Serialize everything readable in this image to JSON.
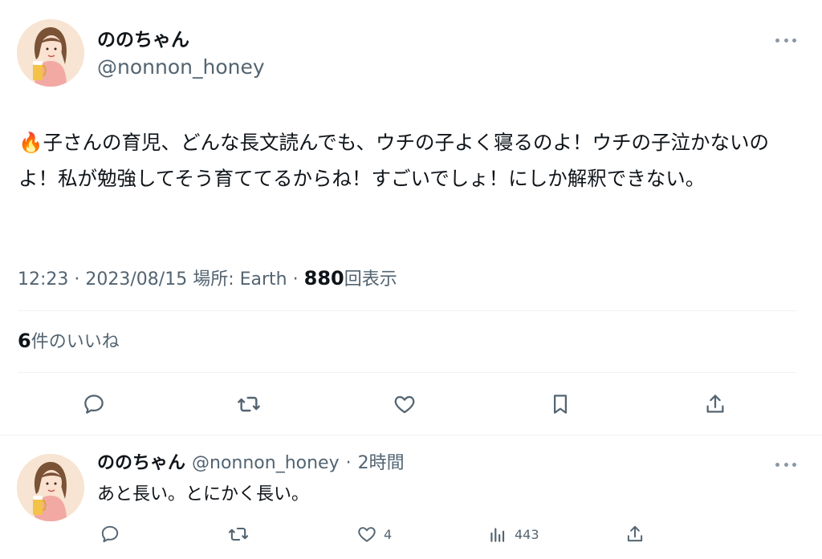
{
  "tweet": {
    "display_name": "ののちゃん",
    "handle": "@nonnon_honey",
    "emoji": "🔥",
    "text": "子さんの育児、どんな長文読んでも、ウチの子よく寝るのよ！ウチの子泣かないのよ！私が勉強してそう育ててるからね！すごいでしょ！にしか解釈できない。",
    "time": "12:23",
    "date": "2023/08/15",
    "place_label": "場所: Earth",
    "views_count": "880",
    "views_label": "回表示",
    "like_count": "6",
    "like_label": "件のいいね",
    "separator": "·"
  },
  "reply": {
    "display_name": "ののちゃん",
    "handle": "@nonnon_honey",
    "separator": "·",
    "age": "2時間",
    "text": "あと長い。とにかく長い。",
    "like_count": "4",
    "views_count": "443"
  },
  "icons": {
    "reply": "reply-icon",
    "retweet": "retweet-icon",
    "like": "heart-icon",
    "bookmark": "bookmark-icon",
    "share": "share-icon",
    "views": "views-icon",
    "more": "more-icon"
  },
  "colors": {
    "text": "#0f1419",
    "secondary": "#536471",
    "divider": "#eff3f4"
  }
}
